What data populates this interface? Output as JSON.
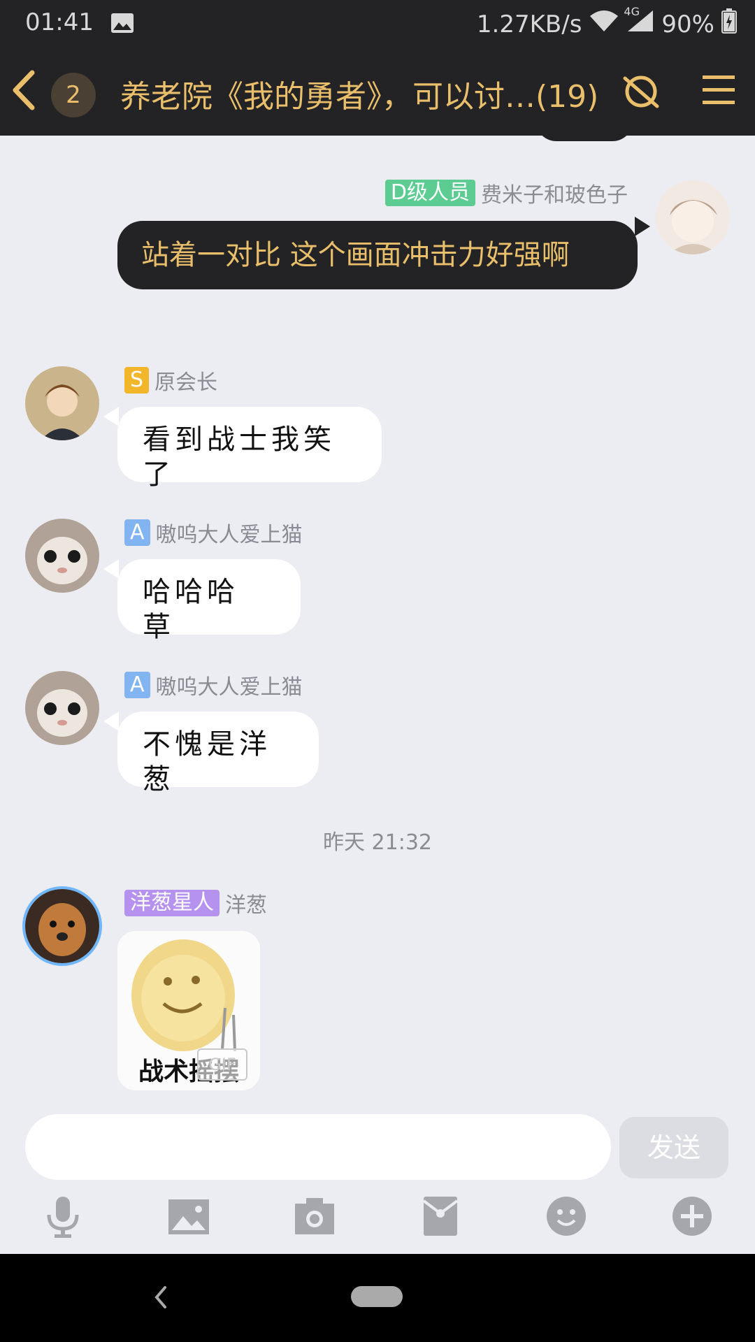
{
  "status_bar": {
    "time": "01:41",
    "network_speed": "1.27KB/s",
    "network_type": "4G",
    "battery": "90%"
  },
  "header": {
    "unread_count": "2",
    "title": "养老院《我的勇者》，可以讨…(19)"
  },
  "messages": [
    {
      "side": "right",
      "badge": "D级人员",
      "badge_color": "#5ccc92",
      "sender": "费米子和玻色子",
      "text": "站着一对比 这个画面冲击力好强啊"
    },
    {
      "side": "left",
      "badge": "S",
      "badge_color": "#f2b62b",
      "sender": "原会长",
      "text": "看到战士我笑了"
    },
    {
      "side": "left",
      "badge": "A",
      "badge_color": "#83b4f2",
      "sender": "嗷呜大人爱上猫",
      "text": "哈哈哈 草"
    },
    {
      "side": "left",
      "badge": "A",
      "badge_color": "#83b4f2",
      "sender": "嗷呜大人爱上猫",
      "text": "不愧是洋葱"
    }
  ],
  "timestamp": "昨天 21:32",
  "sticker_message": {
    "badge": "洋葱星人",
    "badge_color": "#b592ee",
    "sender": "洋葱",
    "sticker_text": "战术摇摆",
    "gif_label": "GIF"
  },
  "composer": {
    "placeholder": "",
    "send_label": "发送"
  },
  "toolbar_icons": [
    "microphone-icon",
    "image-icon",
    "camera-icon",
    "red-packet-icon",
    "emoji-icon",
    "plus-icon"
  ],
  "colors": {
    "header_bg": "#232325",
    "accent_gold": "#e9bf6b",
    "chat_bg": "#ecedf2"
  }
}
